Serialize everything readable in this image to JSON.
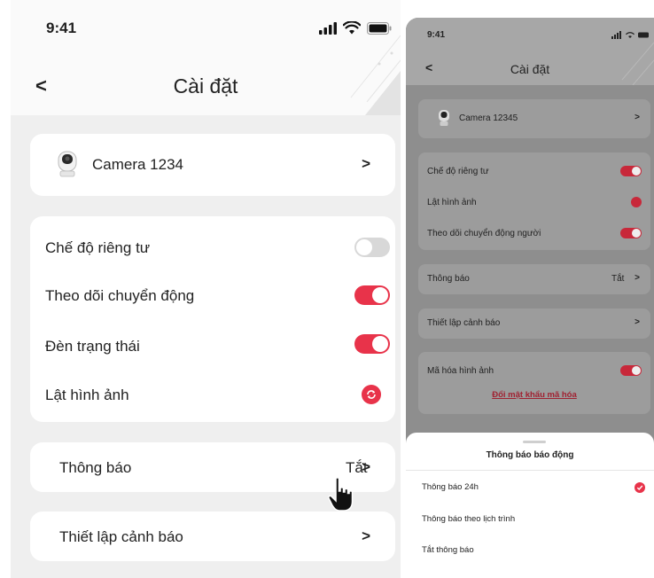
{
  "left_screen": {
    "status": {
      "time": "9:41"
    },
    "header": {
      "title": "Cài đặt"
    },
    "camera": {
      "name": "Camera 1234"
    },
    "settings": [
      {
        "label": "Chế độ riêng tư",
        "control": "toggle",
        "state": "off"
      },
      {
        "label": "Theo dõi chuyển động",
        "control": "toggle",
        "state": "on"
      },
      {
        "label": "Đèn trạng thái",
        "control": "toggle",
        "state": "on"
      },
      {
        "label": "Lật hình ảnh",
        "control": "flip-icon"
      }
    ],
    "notifications": {
      "label": "Thông báo",
      "value": "Tắt"
    },
    "alert_setup": {
      "label": "Thiết lập cảnh báo"
    }
  },
  "right_screen": {
    "status": {
      "time": "9:41"
    },
    "header": {
      "title": "Cài đặt"
    },
    "camera": {
      "name": "Camera 12345"
    },
    "settings": [
      {
        "label": "Chế độ riêng tư",
        "control": "toggle",
        "state": "on"
      },
      {
        "label": "Lật hình ảnh",
        "control": "flip-icon"
      },
      {
        "label": "Theo dõi chuyển động người",
        "control": "toggle",
        "state": "on"
      }
    ],
    "notifications": {
      "label": "Thông báo",
      "value": "Tắt"
    },
    "alert_setup": {
      "label": "Thiết lập cảnh báo"
    },
    "encryption": {
      "label": "Mã hóa hình ảnh",
      "link": "Đổi mật khẩu mã hóa",
      "state": "on"
    },
    "sheet": {
      "title": "Thông báo báo động",
      "options": [
        {
          "label": "Thông báo 24h",
          "selected": true
        },
        {
          "label": "Thông báo theo lịch trình",
          "selected": false
        },
        {
          "label": "Tắt thông báo",
          "selected": false
        }
      ]
    }
  },
  "colors": {
    "accent": "#e8334a",
    "background": "#efefef",
    "card": "#ffffff",
    "toggle_off": "#d8d8d8"
  }
}
